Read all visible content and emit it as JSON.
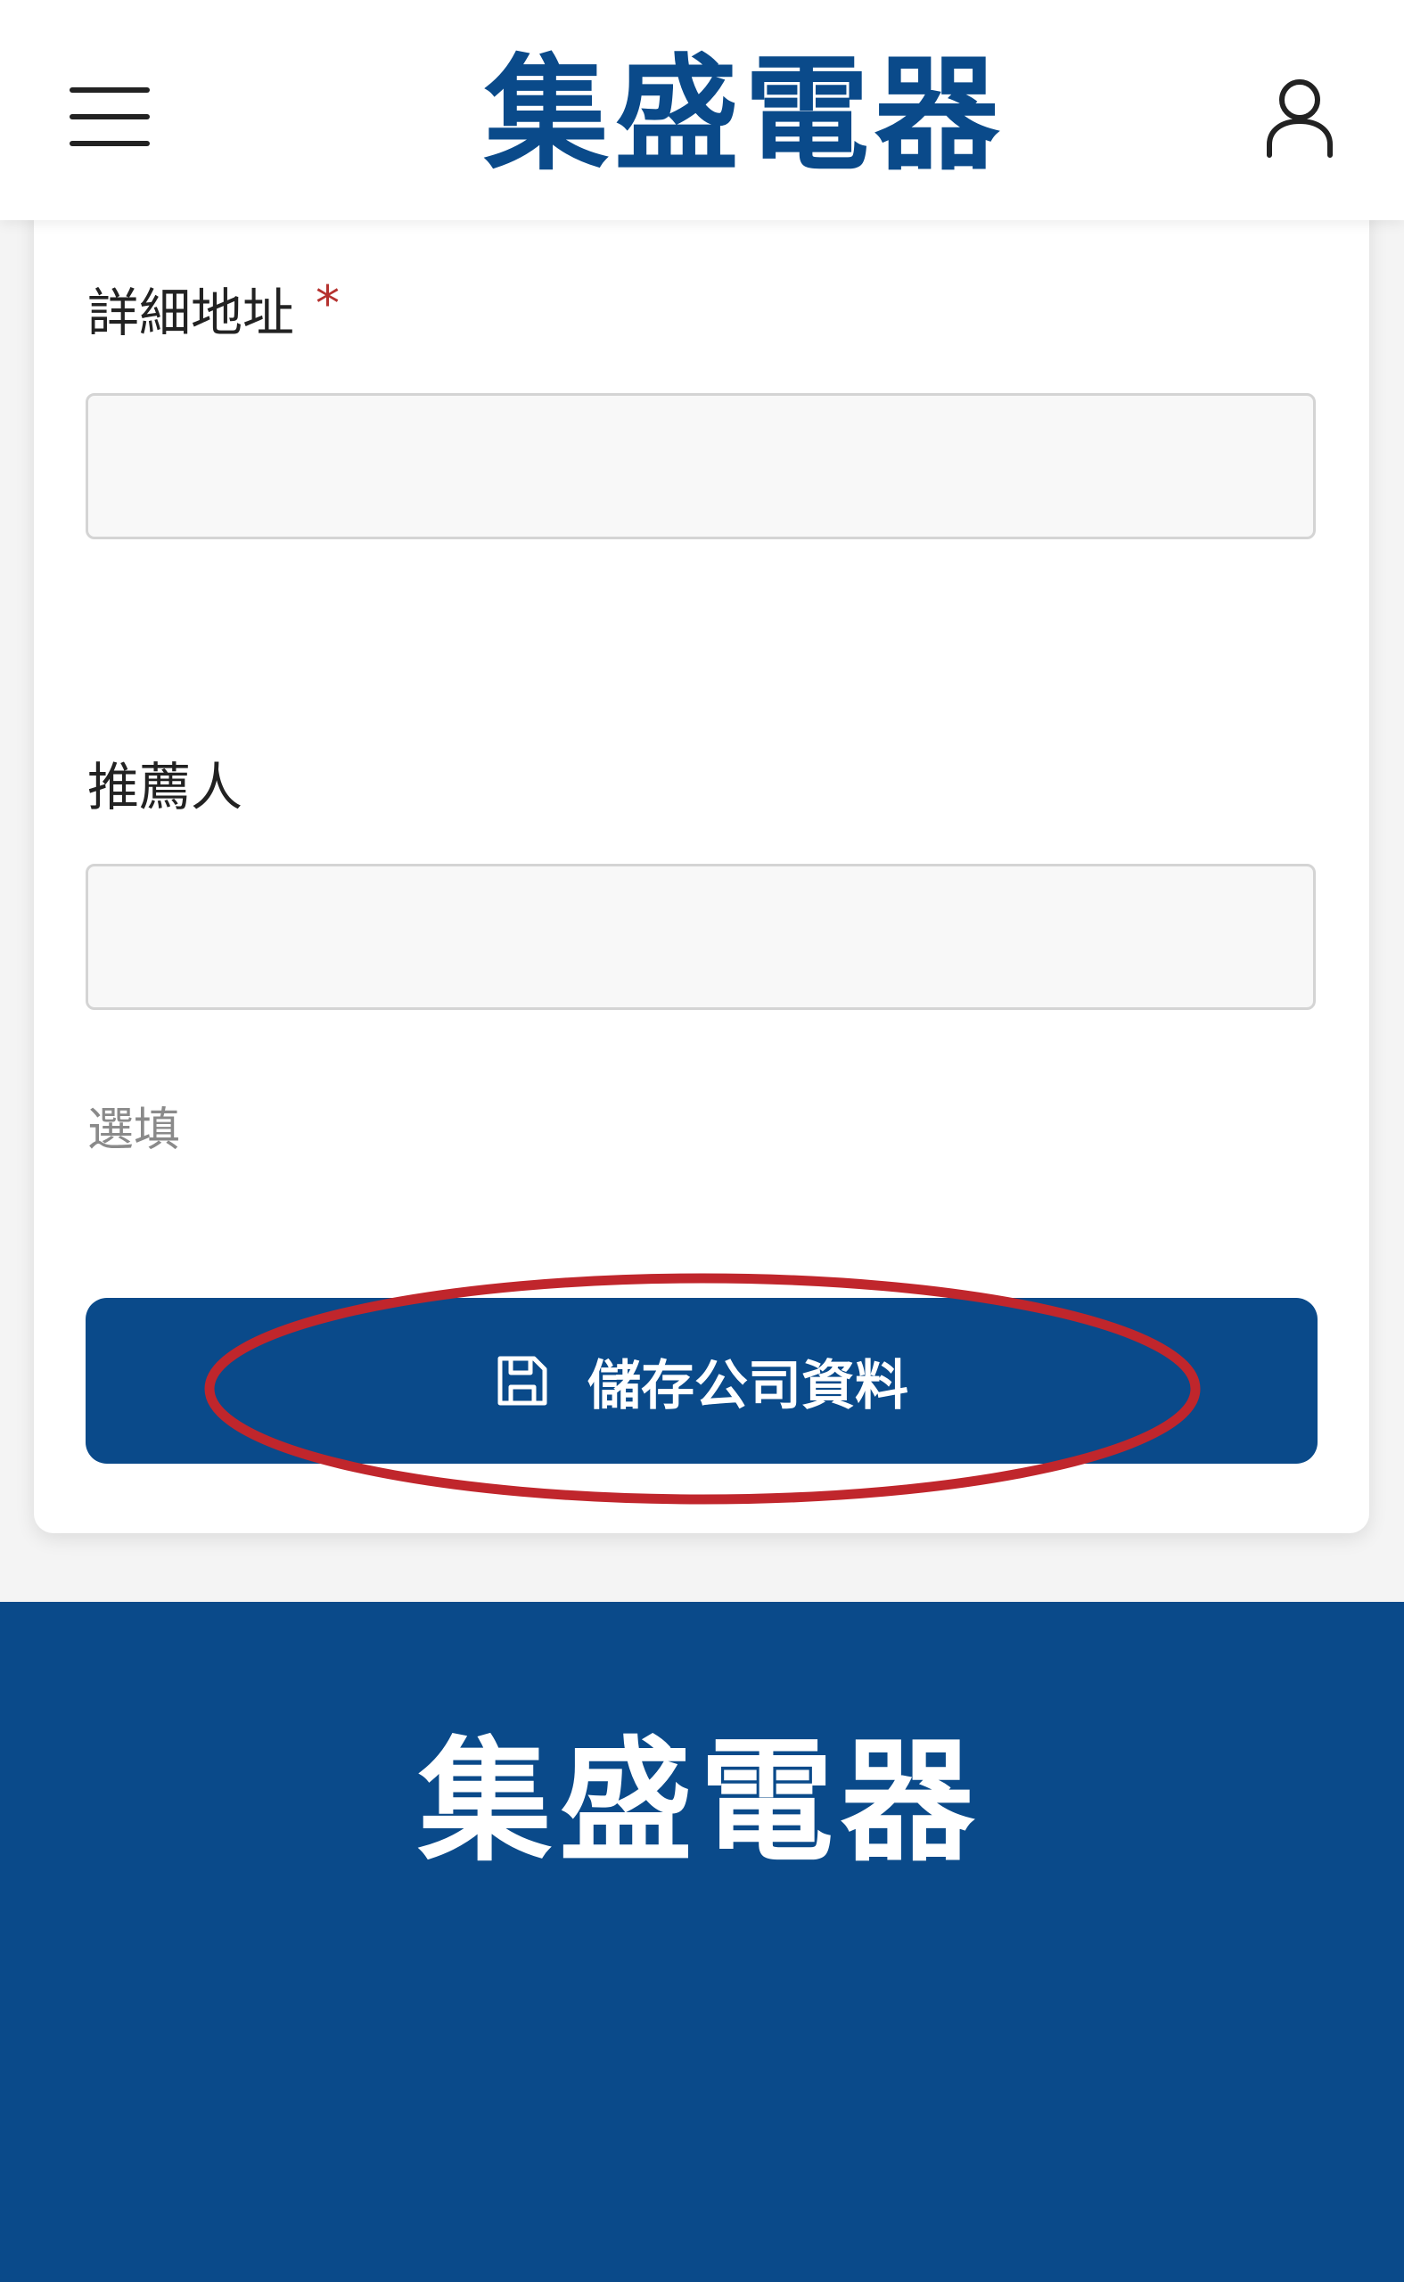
{
  "header": {
    "brand": "集盛電器",
    "menu_icon": "hamburger-menu-icon",
    "user_icon": "user-account-icon"
  },
  "form": {
    "address_label": "詳細地址",
    "required_mark": "*",
    "address_value": "",
    "referrer_label": "推薦人",
    "referrer_value": "",
    "referrer_hint": "選填",
    "save_label": "儲存公司資料",
    "save_icon": "save-floppy-icon"
  },
  "footer": {
    "brand": "集盛電器"
  },
  "colors": {
    "brand_blue": "#0a4a8a",
    "required_red": "#b5322f",
    "annotation_red": "#c0262c"
  }
}
